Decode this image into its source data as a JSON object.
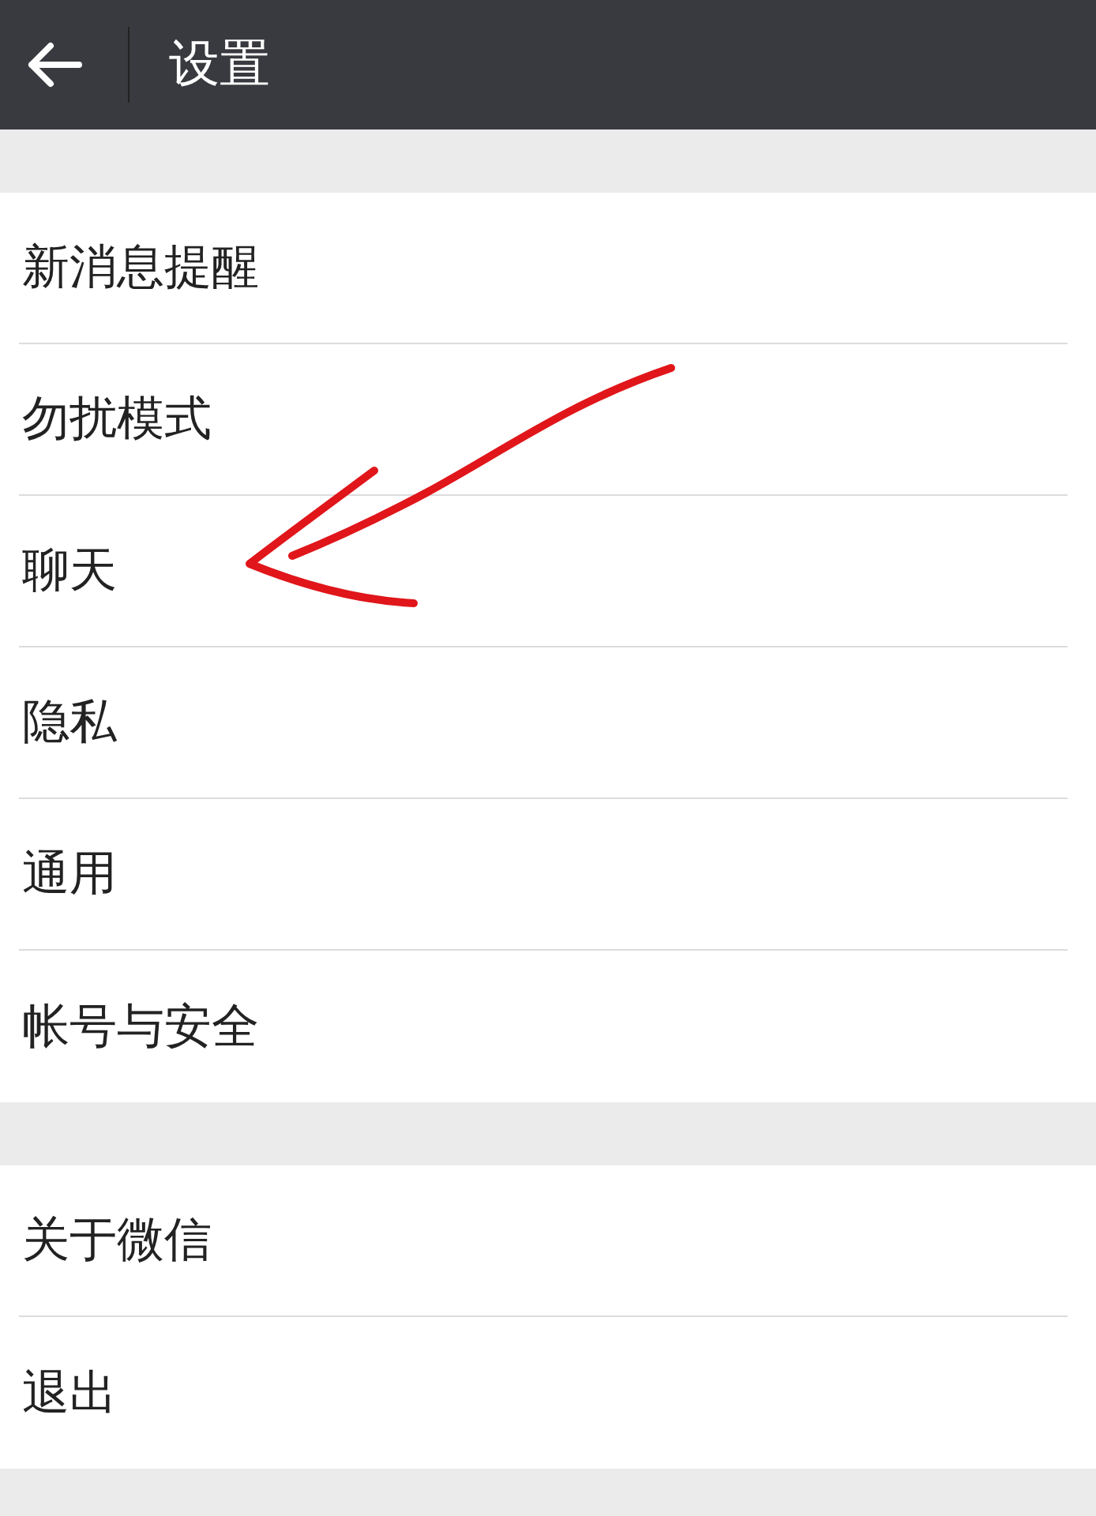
{
  "header": {
    "title": "设置"
  },
  "groups": [
    {
      "items": [
        {
          "label": "新消息提醒"
        },
        {
          "label": "勿扰模式"
        },
        {
          "label": "聊天"
        },
        {
          "label": "隐私"
        },
        {
          "label": "通用"
        },
        {
          "label": "帐号与安全"
        }
      ]
    },
    {
      "items": [
        {
          "label": "关于微信"
        },
        {
          "label": "退出"
        }
      ]
    }
  ]
}
